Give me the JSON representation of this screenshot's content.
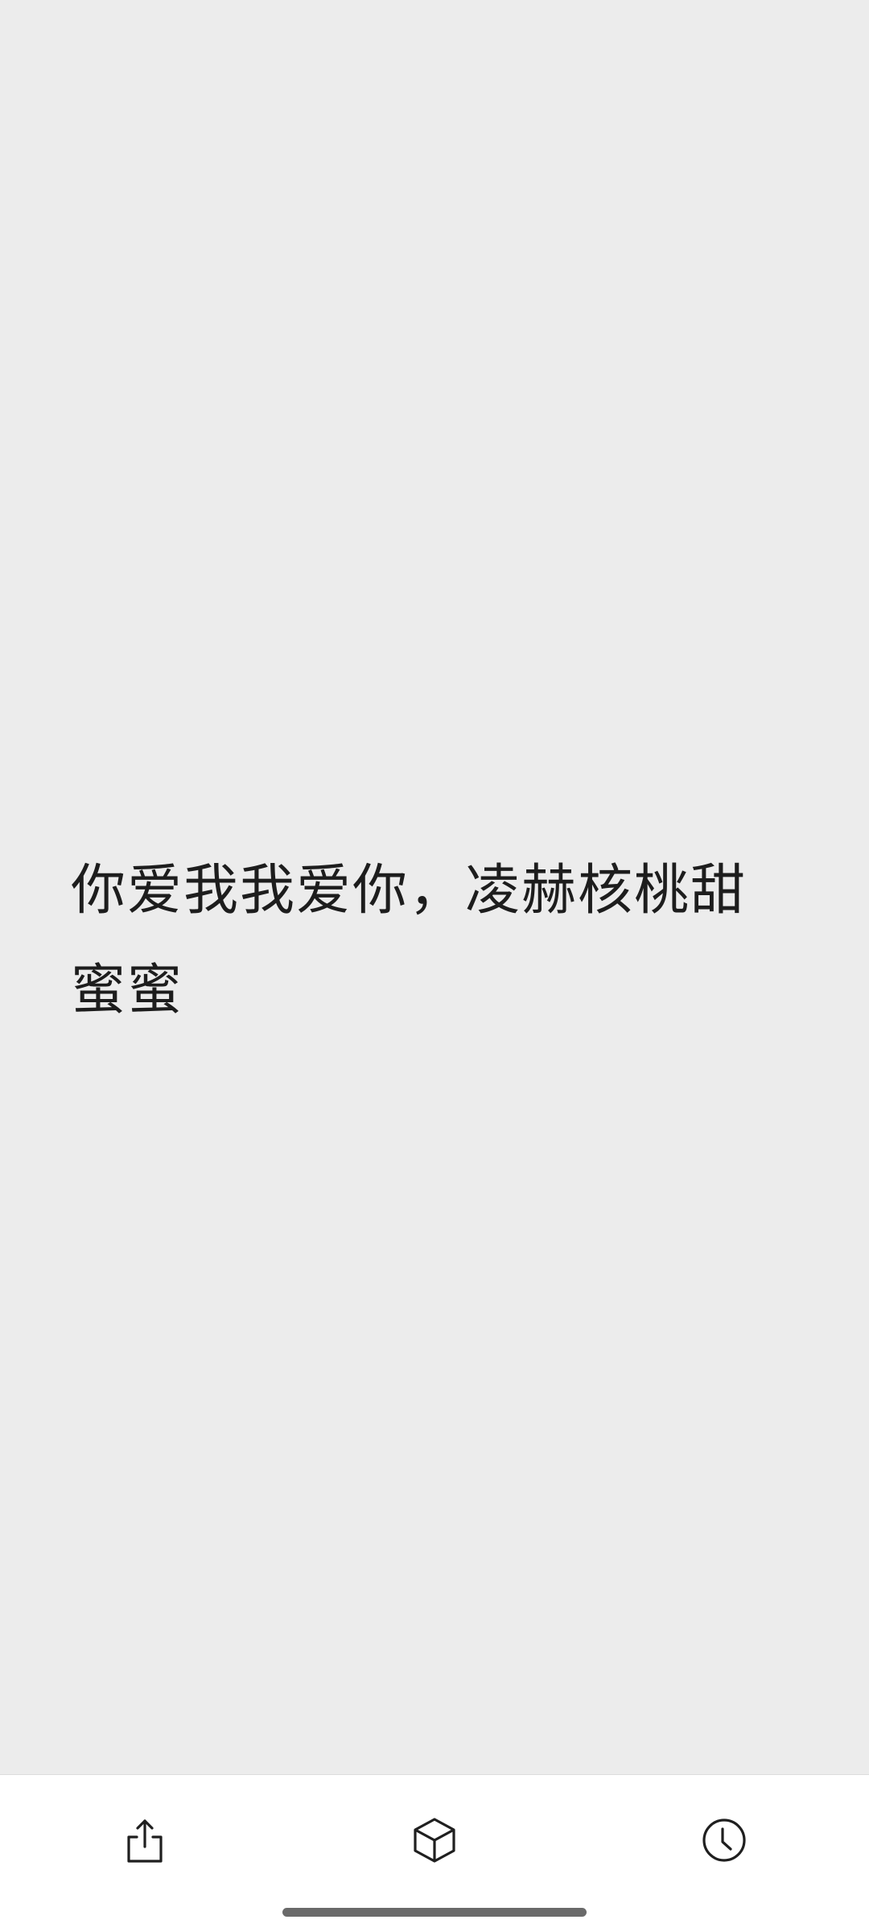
{
  "note": {
    "text": "你爱我我爱你，凌赫核桃甜蜜蜜"
  },
  "toolbar": {
    "buttons": [
      {
        "icon": "share-icon"
      },
      {
        "icon": "cube-icon"
      },
      {
        "icon": "clock-icon"
      }
    ]
  },
  "colors": {
    "background": "#ececec",
    "toolbar": "#ffffff",
    "text": "#1d1d1d",
    "icon": "#1f1f1f"
  }
}
